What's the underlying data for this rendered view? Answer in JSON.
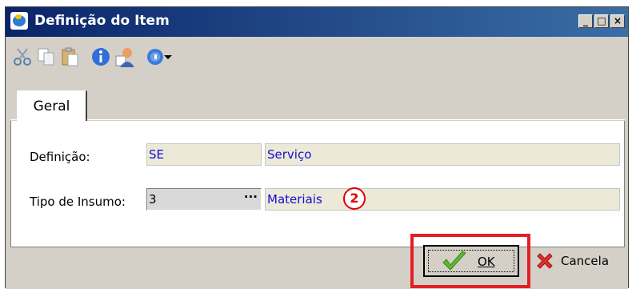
{
  "window": {
    "title": "Definição do Item",
    "controls": {
      "minimize": "_",
      "maximize": "□",
      "close": "×"
    }
  },
  "toolbar": {
    "icons": [
      "cut-icon",
      "copy-icon",
      "paste-icon",
      "info-icon",
      "user-icon",
      "help-icon",
      "dropdown-arrow-icon"
    ]
  },
  "tabs": [
    {
      "label": "Geral",
      "active": true
    }
  ],
  "form": {
    "definicao": {
      "label": "Definição:",
      "code": "SE",
      "description": "Serviço"
    },
    "tipo_insumo": {
      "label": "Tipo de Insumo:",
      "code": "3",
      "button": "···",
      "description": "Materiais"
    }
  },
  "callout": {
    "number": "2",
    "color": "#e00000"
  },
  "buttons": {
    "ok": "OK",
    "cancel": "Cancela"
  },
  "colors": {
    "title_bar_start": "#0a246a",
    "title_bar_end": "#3a6ea5",
    "field_text": "#1010d0",
    "highlight": "#e31f26"
  }
}
